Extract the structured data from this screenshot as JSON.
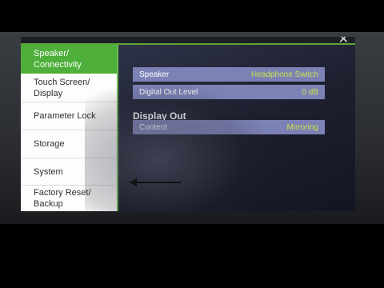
{
  "sidebar": {
    "items": [
      {
        "label_1": "Speaker/",
        "label_2": "Connectivity"
      },
      {
        "label_1": "Touch Screen/",
        "label_2": "Display"
      },
      {
        "label_1": "Parameter Lock"
      },
      {
        "label_1": "Storage"
      },
      {
        "label_1": "System"
      },
      {
        "label_1": "Factory Reset/",
        "label_2": "Backup"
      }
    ],
    "active_index": 0
  },
  "main": {
    "rows": [
      {
        "label": "Speaker",
        "value": "Headphone Switch"
      },
      {
        "label": "Digital Out Level",
        "value": "0 dB"
      }
    ],
    "section_title": "Display Out",
    "section_rows": [
      {
        "label": "Content",
        "value": "Mirroring"
      }
    ]
  },
  "window": {
    "close_icon": "close-icon"
  },
  "colors": {
    "accent": "#4eaf3b",
    "row_bg": "#7d82b6",
    "value_text": "#c9e04a"
  }
}
